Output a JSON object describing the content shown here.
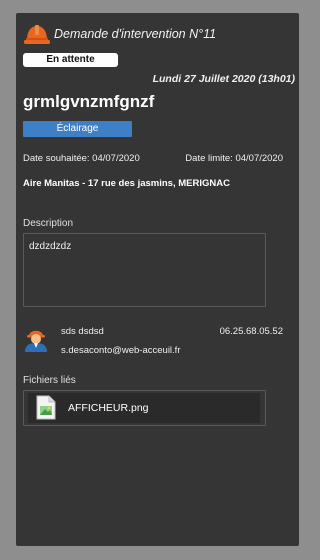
{
  "header": {
    "title": "Demande d'intervention N°11",
    "helmet_icon": "hard-hat-icon",
    "helmet_color": "#e8661f"
  },
  "status": {
    "label": "En attente"
  },
  "date": "Lundi 27 Juillet 2020 (13h01)",
  "subject": "grmlgvnzmfgnzf",
  "category": {
    "label": "Éclairage",
    "color": "#3f7fc6"
  },
  "dates": {
    "wished": "Date souhaitée: 04/07/2020",
    "due": "Date limite: 04/07/2020"
  },
  "address": "Aire Manitas - 17 rue des jasmins, MERIGNAC",
  "description": {
    "label": "Description",
    "text": "dzdzdzdz"
  },
  "contact": {
    "name": "sds dsdsd",
    "email": "s.desaconto@web-acceuil.fr",
    "phone": "06.25.68.05.52",
    "avatar_icon": "user-avatar-icon"
  },
  "files": {
    "label": "Fichiers liés",
    "items": [
      {
        "name": "AFFICHEUR.png",
        "icon": "image-file-icon"
      }
    ]
  }
}
